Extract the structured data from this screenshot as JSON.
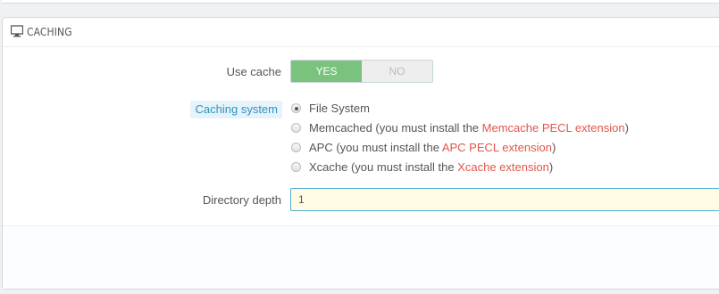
{
  "panel": {
    "title": "CACHING",
    "icon": "desktop-icon"
  },
  "use_cache": {
    "label": "Use cache",
    "yes_label": "YES",
    "no_label": "NO",
    "selected": "YES"
  },
  "caching_system": {
    "label": "Caching system",
    "options": [
      {
        "label": "File System",
        "checked": true,
        "prefix": "File System",
        "link": "",
        "suffix": ""
      },
      {
        "label": "Memcached",
        "checked": false,
        "prefix": "Memcached (you must install the ",
        "link": "Memcache PECL extension",
        "suffix": ")"
      },
      {
        "label": "APC",
        "checked": false,
        "prefix": "APC (you must install the ",
        "link": "APC PECL extension",
        "suffix": ")"
      },
      {
        "label": "Xcache",
        "checked": false,
        "prefix": "Xcache (you must install the ",
        "link": "Xcache extension",
        "suffix": ")"
      }
    ]
  },
  "directory_depth": {
    "label": "Directory depth",
    "value": "1"
  },
  "colors": {
    "toggle_on": "#79c37d",
    "link": "#e1564b",
    "label_highlight_bg": "#e6f3fb",
    "label_highlight_text": "#2f92c4",
    "input_bg": "#fffbe5",
    "input_border": "#50b0d0"
  }
}
